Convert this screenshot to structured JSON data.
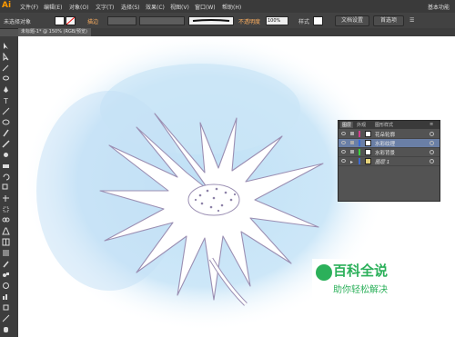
{
  "app": {
    "logo": "Ai"
  },
  "menus": [
    "文件(F)",
    "编辑(E)",
    "对象(O)",
    "文字(T)",
    "选择(S)",
    "效果(C)",
    "视图(V)",
    "窗口(W)",
    "帮助(H)"
  ],
  "workspace": "基本功能",
  "control_bar": {
    "selection": "未选择对象",
    "stroke_label": "描边",
    "opacity_label": "不透明度",
    "opacity_value": "100%",
    "style_label": "样式",
    "doc_setup": "文档设置",
    "preferences": "首选项"
  },
  "document_tab": {
    "title": "未标题-1* @ 150% (RGB/预览)"
  },
  "layers_panel": {
    "tabs": [
      "图层",
      "外观",
      "图形样式"
    ],
    "layers": [
      {
        "name": "花朵轮廓",
        "color": "#d23c8c",
        "selected": false
      },
      {
        "name": "水彩纹理",
        "color": "#3c6ad2",
        "selected": true
      },
      {
        "name": "水彩背景",
        "color": "#3cd23c",
        "selected": false
      },
      {
        "name": "图层 1",
        "color": "#3c6ad2",
        "selected": false
      }
    ]
  },
  "watermark": {
    "main": "百科全说",
    "sub": "助你轻松解决"
  }
}
